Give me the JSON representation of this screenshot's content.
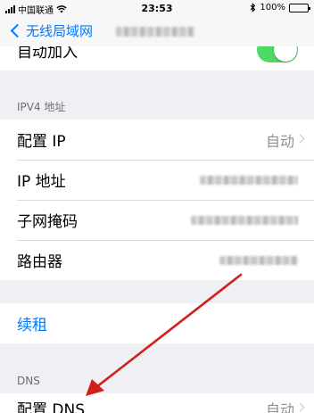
{
  "statusbar": {
    "carrier": "中国联通",
    "time": "23:53",
    "battery": "100%",
    "battery_level": 1.0
  },
  "nav": {
    "back_label": "无线局域网"
  },
  "auto_join": {
    "label": "自动加入",
    "enabled": true
  },
  "ipv4": {
    "header": "IPV4 地址",
    "configure_ip_label": "配置 IP",
    "configure_ip_value": "自动",
    "ip_label": "IP 地址",
    "subnet_label": "子网掩码",
    "router_label": "路由器"
  },
  "renew_label": "续租",
  "dns": {
    "header": "DNS",
    "configure_label": "配置 DNS",
    "configure_value": "自动"
  },
  "colors": {
    "accent": "#007aff",
    "toggle_on": "#4cd964",
    "arrow": "#d0201a"
  }
}
